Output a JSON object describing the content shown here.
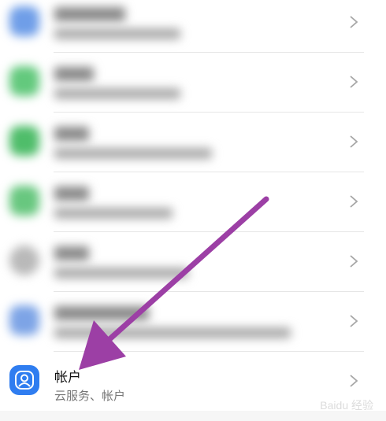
{
  "colors": {
    "background": "#f6f6f6",
    "row_background": "#ffffff",
    "divider": "#e6e6e6",
    "annotation_arrow": "#9c3fa5",
    "account_icon": "#2f7df0"
  },
  "settings_list": {
    "blurred_rows": [
      {
        "icon_color": "#6f9ee8"
      },
      {
        "icon_color": "#63c97d"
      },
      {
        "icon_color": "#4fbd6a"
      },
      {
        "icon_color": "#68c77f"
      },
      {
        "icon_color": "#b9b9b9"
      },
      {
        "icon_color": "#7da4e6"
      }
    ],
    "account_row": {
      "title": "帐户",
      "subtitle": "云服务、帐户",
      "icon": "person-icon"
    }
  },
  "icons": {
    "chevron": "chevron-right-icon",
    "annotation": "arrow-annotation"
  },
  "watermark": {
    "text": "Baidu 经验"
  }
}
